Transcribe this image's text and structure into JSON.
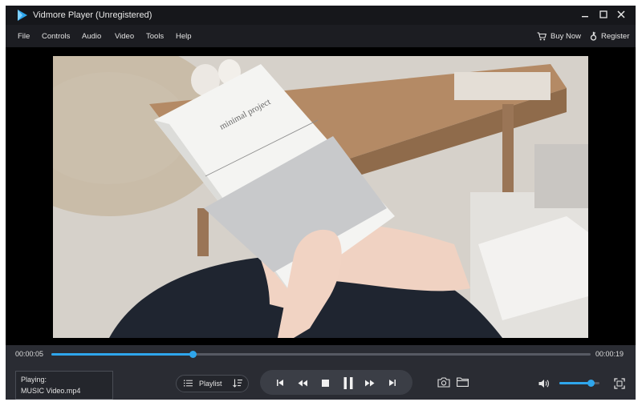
{
  "window": {
    "title": "Vidmore Player (Unregistered)"
  },
  "menu": {
    "items": [
      "File",
      "Controls",
      "Audio",
      "Video",
      "Tools",
      "Help"
    ],
    "buy_now": "Buy Now",
    "register": "Register"
  },
  "playback": {
    "current_time": "00:00:05",
    "total_time": "00:00:19",
    "progress": 0.262,
    "volume": 0.78
  },
  "now_playing": {
    "label": "Playing:",
    "file": "MUSIC Video.mp4"
  },
  "playlist": {
    "label": "Playlist"
  },
  "video": {
    "book_title": "minimal project"
  },
  "colors": {
    "accent": "#2fa6ec",
    "background": "#1c1d22",
    "controls": "#2a2c33"
  }
}
